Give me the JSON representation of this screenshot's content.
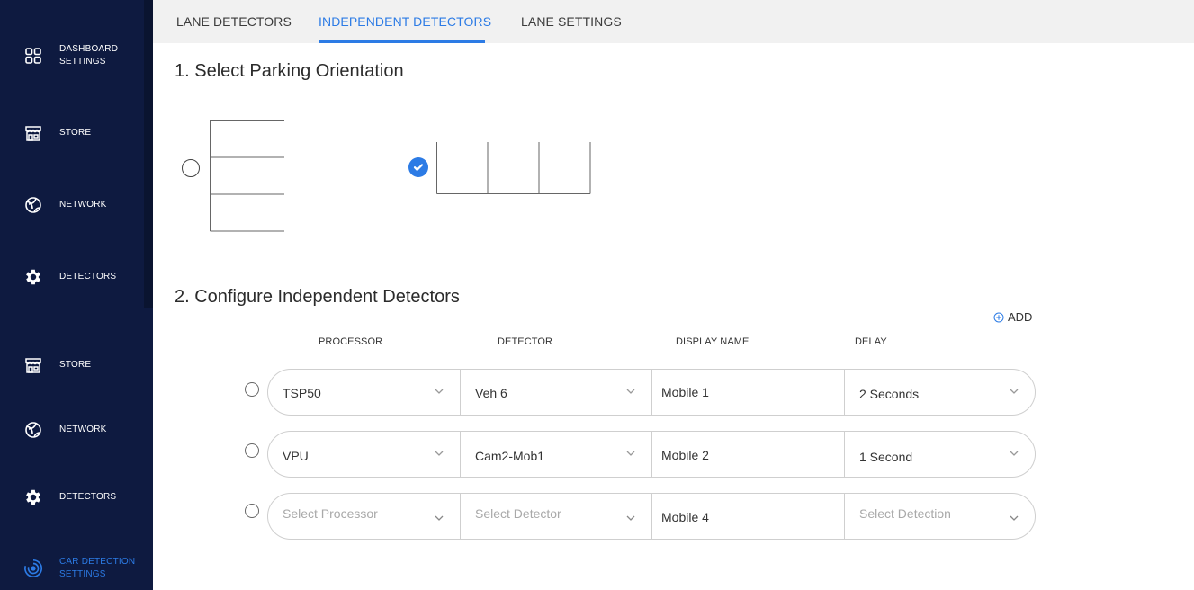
{
  "sidebar": {
    "items": [
      {
        "label_1": "DASHBOARD",
        "label_2": "SETTINGS",
        "icon": "grid-icon"
      },
      {
        "label": "STORE",
        "icon": "store-icon"
      },
      {
        "label": "NETWORK",
        "icon": "globe-icon"
      },
      {
        "label": "DETECTORS",
        "icon": "gear-icon"
      },
      {
        "label": "STORE",
        "icon": "store-icon"
      },
      {
        "label": "NETWORK",
        "icon": "globe-icon"
      },
      {
        "label": "DETECTORS",
        "icon": "gear-icon"
      },
      {
        "label_1": "CAR DETECTION",
        "label_2": "SETTINGS",
        "icon": "radar-icon",
        "active": true
      }
    ]
  },
  "tabs": [
    {
      "label": "LANE DETECTORS"
    },
    {
      "label": "INDEPENDENT DETECTORS",
      "active": true
    },
    {
      "label": "LANE SETTINGS"
    }
  ],
  "section1": {
    "title": "1. Select Parking Orientation"
  },
  "orientation": {
    "selected": "vertical-bays"
  },
  "section2": {
    "title": "2. Configure Independent Detectors"
  },
  "add_label": "ADD",
  "columns": [
    "PROCESSOR",
    "DETECTOR",
    "DISPLAY NAME",
    "DELAY"
  ],
  "rows": [
    {
      "processor": "TSP50",
      "detector": "Veh 6",
      "display_name": "Mobile 1",
      "delay": "2 Seconds"
    },
    {
      "processor": "VPU",
      "detector": "Cam2-Mob1",
      "display_name": "Mobile 2",
      "delay": "1 Second"
    },
    {
      "processor": "Select Processor",
      "detector": "Select Detector",
      "display_name": "Mobile 4",
      "delay": "Select Detection",
      "placeholder": true
    }
  ],
  "colors": {
    "sidebar_bg": "#0e1a40",
    "accent": "#2c7be5",
    "tabs_bg": "#f1f1f1"
  }
}
